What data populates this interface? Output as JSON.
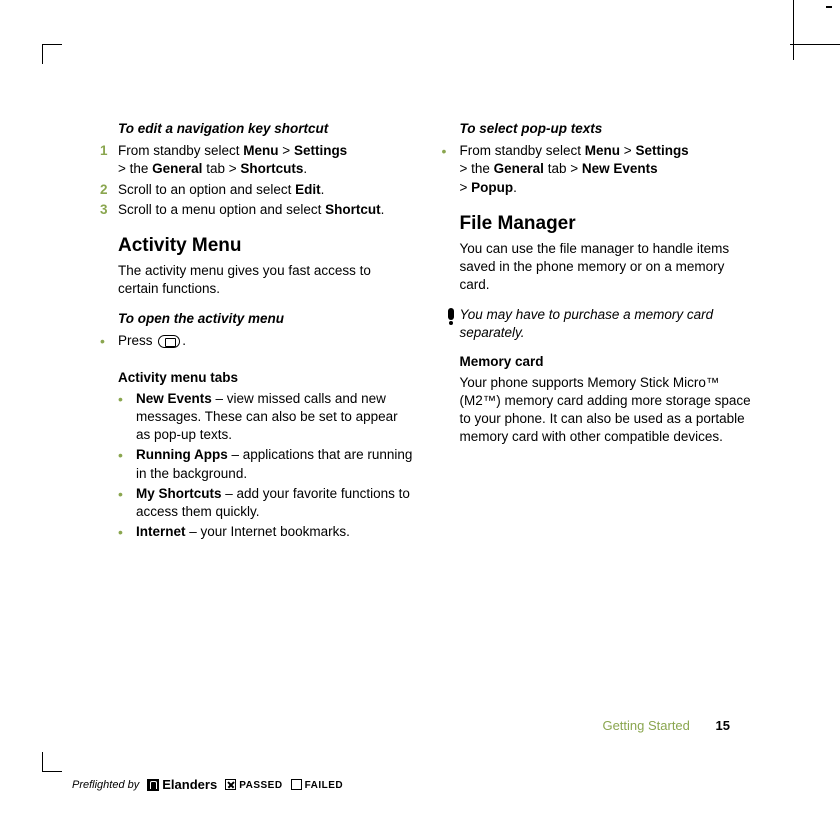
{
  "col1": {
    "edit_shortcut_heading": "To edit a navigation key shortcut",
    "steps": [
      {
        "n": "1",
        "pre": "From standby select ",
        "b1": "Menu",
        "mid": " > ",
        "b2": "Settings",
        "line2_pre": "> the ",
        "b3": "General",
        "line2_mid": " tab > ",
        "b4": "Shortcuts",
        "end": "."
      },
      {
        "n": "2",
        "pre": "Scroll to an option and select ",
        "b1": "Edit",
        "end": "."
      },
      {
        "n": "3",
        "pre": "Scroll to a menu option and select ",
        "b1": "Shortcut",
        "end": "."
      }
    ],
    "activity_menu_heading": "Activity Menu",
    "activity_menu_body": "The activity menu gives you fast access to certain functions.",
    "open_activity_heading": "To open the activity menu",
    "press_label": "Press ",
    "press_end": ".",
    "tabs_heading": "Activity menu tabs",
    "tabs": [
      {
        "b": "New Events",
        "t": " – view missed calls and new messages. These can also be set to appear as pop-up texts."
      },
      {
        "b": "Running Apps",
        "t": " – applications that are running in the background."
      },
      {
        "b": "My Shortcuts",
        "t": " – add your favorite functions to access them quickly."
      },
      {
        "b": "Internet",
        "t": " – your Internet bookmarks."
      }
    ]
  },
  "col2": {
    "popup_heading": "To select pop-up texts",
    "popup_pre": "From standby select ",
    "popup_b1": "Menu",
    "popup_mid": " > ",
    "popup_b2": "Settings",
    "popup_l2_pre": "> the ",
    "popup_b3": "General",
    "popup_l2_mid": " tab > ",
    "popup_b4": "New Events",
    "popup_l3_pre": "> ",
    "popup_b5": "Popup",
    "popup_end": ".",
    "fm_heading": "File Manager",
    "fm_body": "You can use the file manager to handle items saved in the phone memory or on a memory card.",
    "note": "You may have to purchase a memory card separately.",
    "mc_heading": "Memory card",
    "mc_body": "Your phone supports Memory Stick Micro™ (M2™) memory card adding more storage space to your phone. It can also be used as a portable memory card with other compatible devices."
  },
  "footer": {
    "section": "Getting Started",
    "page": "15"
  },
  "preflight": {
    "by": "Preflighted by",
    "brand": "Elanders",
    "passed": "PASSED",
    "failed": "FAILED"
  }
}
